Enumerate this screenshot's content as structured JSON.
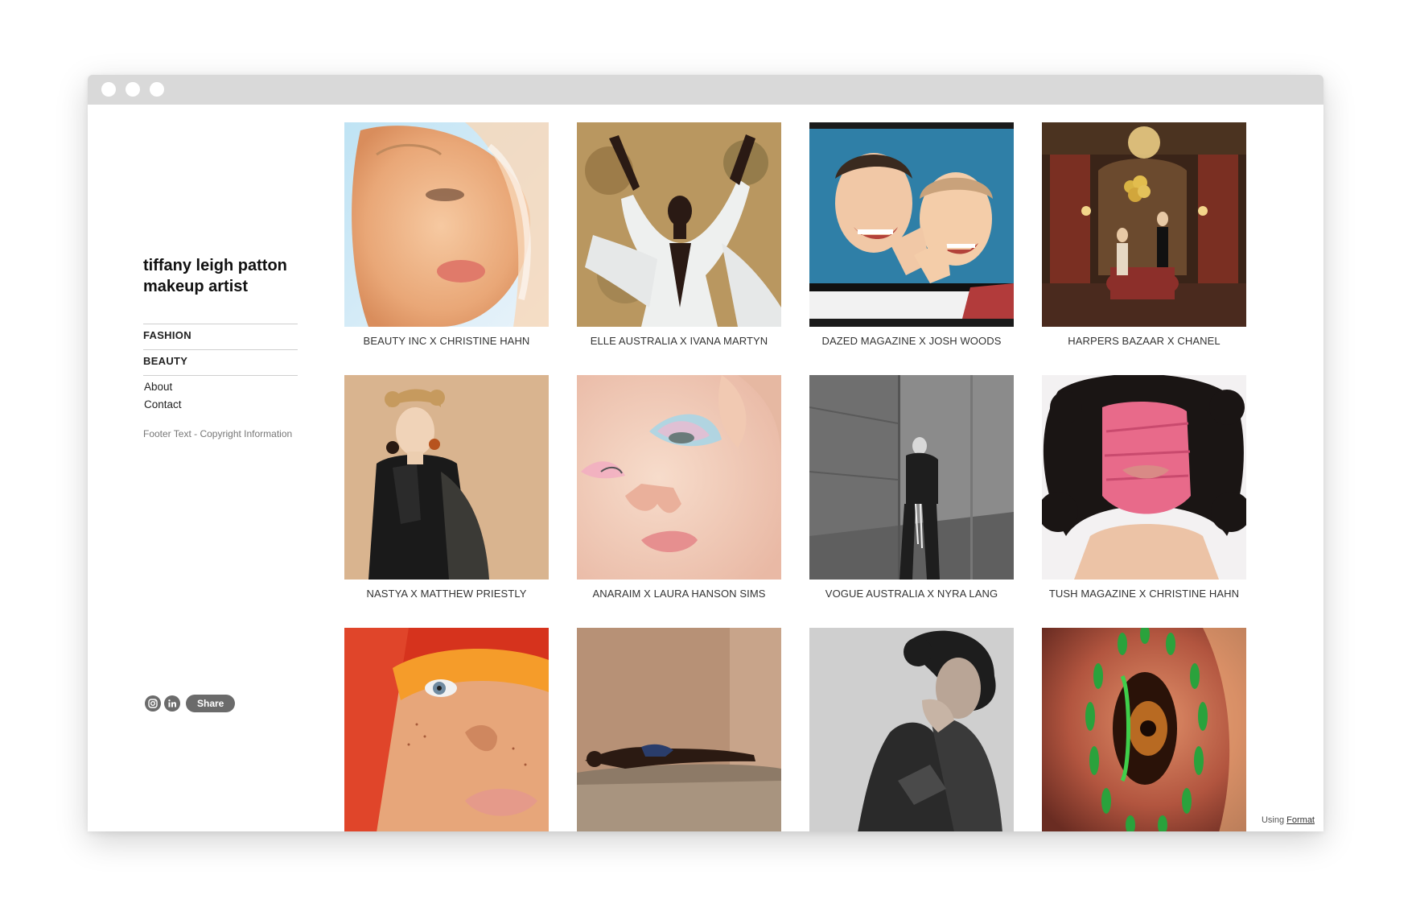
{
  "sidebar": {
    "title_line1": "tiffany leigh patton",
    "title_line2": "makeup artist",
    "nav": [
      {
        "label": "FASHION"
      },
      {
        "label": "BEAUTY"
      }
    ],
    "links": [
      {
        "label": "About"
      },
      {
        "label": "Contact"
      }
    ],
    "footer_text": "Footer Text - Copyright Information",
    "social": {
      "instagram_icon": "instagram-icon",
      "linkedin_icon": "linkedin-icon",
      "share_label": "Share"
    }
  },
  "gallery": {
    "items": [
      {
        "caption": "BEAUTY INC X CHRISTINE HAHN"
      },
      {
        "caption": "ELLE AUSTRALIA X IVANA MARTYN"
      },
      {
        "caption": "DAZED MAGAZINE X JOSH WOODS"
      },
      {
        "caption": "HARPERS BAZAAR X CHANEL"
      },
      {
        "caption": "NASTYA X MATTHEW PRIESTLY"
      },
      {
        "caption": "ANARAIM X LAURA HANSON SIMS"
      },
      {
        "caption": "VOGUE AUSTRALIA X NYRA LANG"
      },
      {
        "caption": "TUSH MAGAZINE X CHRISTINE HAHN"
      },
      {
        "caption": ""
      },
      {
        "caption": ""
      },
      {
        "caption": ""
      },
      {
        "caption": ""
      }
    ]
  },
  "footer": {
    "using_label": "Using",
    "format_link": "Format"
  },
  "colors": {
    "titlebar": "#d9d9d9",
    "social_bg": "#6b6b6b",
    "divider": "#cfcfcf"
  }
}
